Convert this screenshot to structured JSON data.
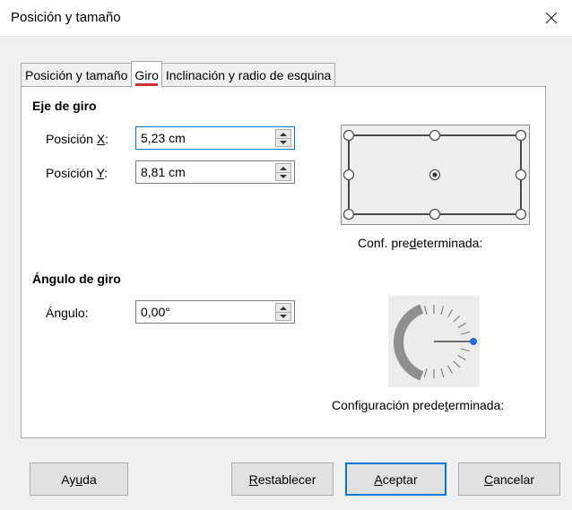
{
  "window": {
    "title": "Posición y tamaño",
    "close_icon": "close-icon"
  },
  "tabs": [
    {
      "label": "Posición y tamaño",
      "active": false
    },
    {
      "label": "Giro",
      "active": true
    },
    {
      "label": "Inclinación y radio de esquina",
      "active": false
    }
  ],
  "pivot": {
    "section_title": "Eje de giro",
    "x_label_pre": "Posición ",
    "x_label_key": "X",
    "x_label_post": ":",
    "x_value": "5,23 cm",
    "y_label_pre": "Posición ",
    "y_label_key": "Y",
    "y_label_post": ":",
    "y_value": "8,81 cm",
    "default_caption_pre": "Conf. pre",
    "default_caption_key": "d",
    "default_caption_post": "eterminada:"
  },
  "angle": {
    "section_title": "Ángulo de giro",
    "label_pre": "Án",
    "label_key": "g",
    "label_post": "ulo:",
    "value": "0,00°",
    "default_caption_pre": "Configuración prede",
    "default_caption_key": "t",
    "default_caption_post": "erminada:"
  },
  "buttons": {
    "help_pre": "Ay",
    "help_key": "u",
    "help_post": "da",
    "reset_key": "R",
    "reset_post": "establecer",
    "ok_key": "A",
    "ok_post": "ceptar",
    "cancel_key": "C",
    "cancel_post": "ancelar"
  },
  "colors": {
    "accent": "#0078d7",
    "active_tab_underline": "#d32f2f"
  }
}
